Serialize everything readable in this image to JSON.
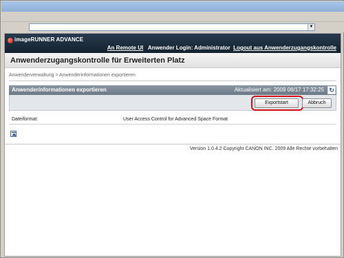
{
  "header": {
    "brand": "imageRUNNER ADVANCE",
    "remote_ui_link": "An Remote UI",
    "login_text": "Anwender Login: Administrator",
    "logout_link": "Logout aus Anwenderzugangskontrolle"
  },
  "page": {
    "title": "Anwenderzugangskontrolle für Erweiterten Platz",
    "breadcrumb": "Anwenderverwaltung > Anwenderinformationen exportieren"
  },
  "panel": {
    "title": "Anwenderinformationen exportieren",
    "updated": "Aktualisiert am: 2009 06/17 17:32:25"
  },
  "actions": {
    "export_label": "Exportstart",
    "cancel_label": "Abbruch"
  },
  "fields": [
    {
      "label": "Dateiformat:",
      "value": "User Access Control for Advanced Space Format"
    }
  ],
  "footer": {
    "text": "Version 1.0.4.2 Copyright CANON INC. 2009 Alle Rechte vorbehalten"
  },
  "colors": {
    "banner": "#1c2d3d",
    "panel_header": "#7a8794",
    "highlight": "#d3121e"
  }
}
